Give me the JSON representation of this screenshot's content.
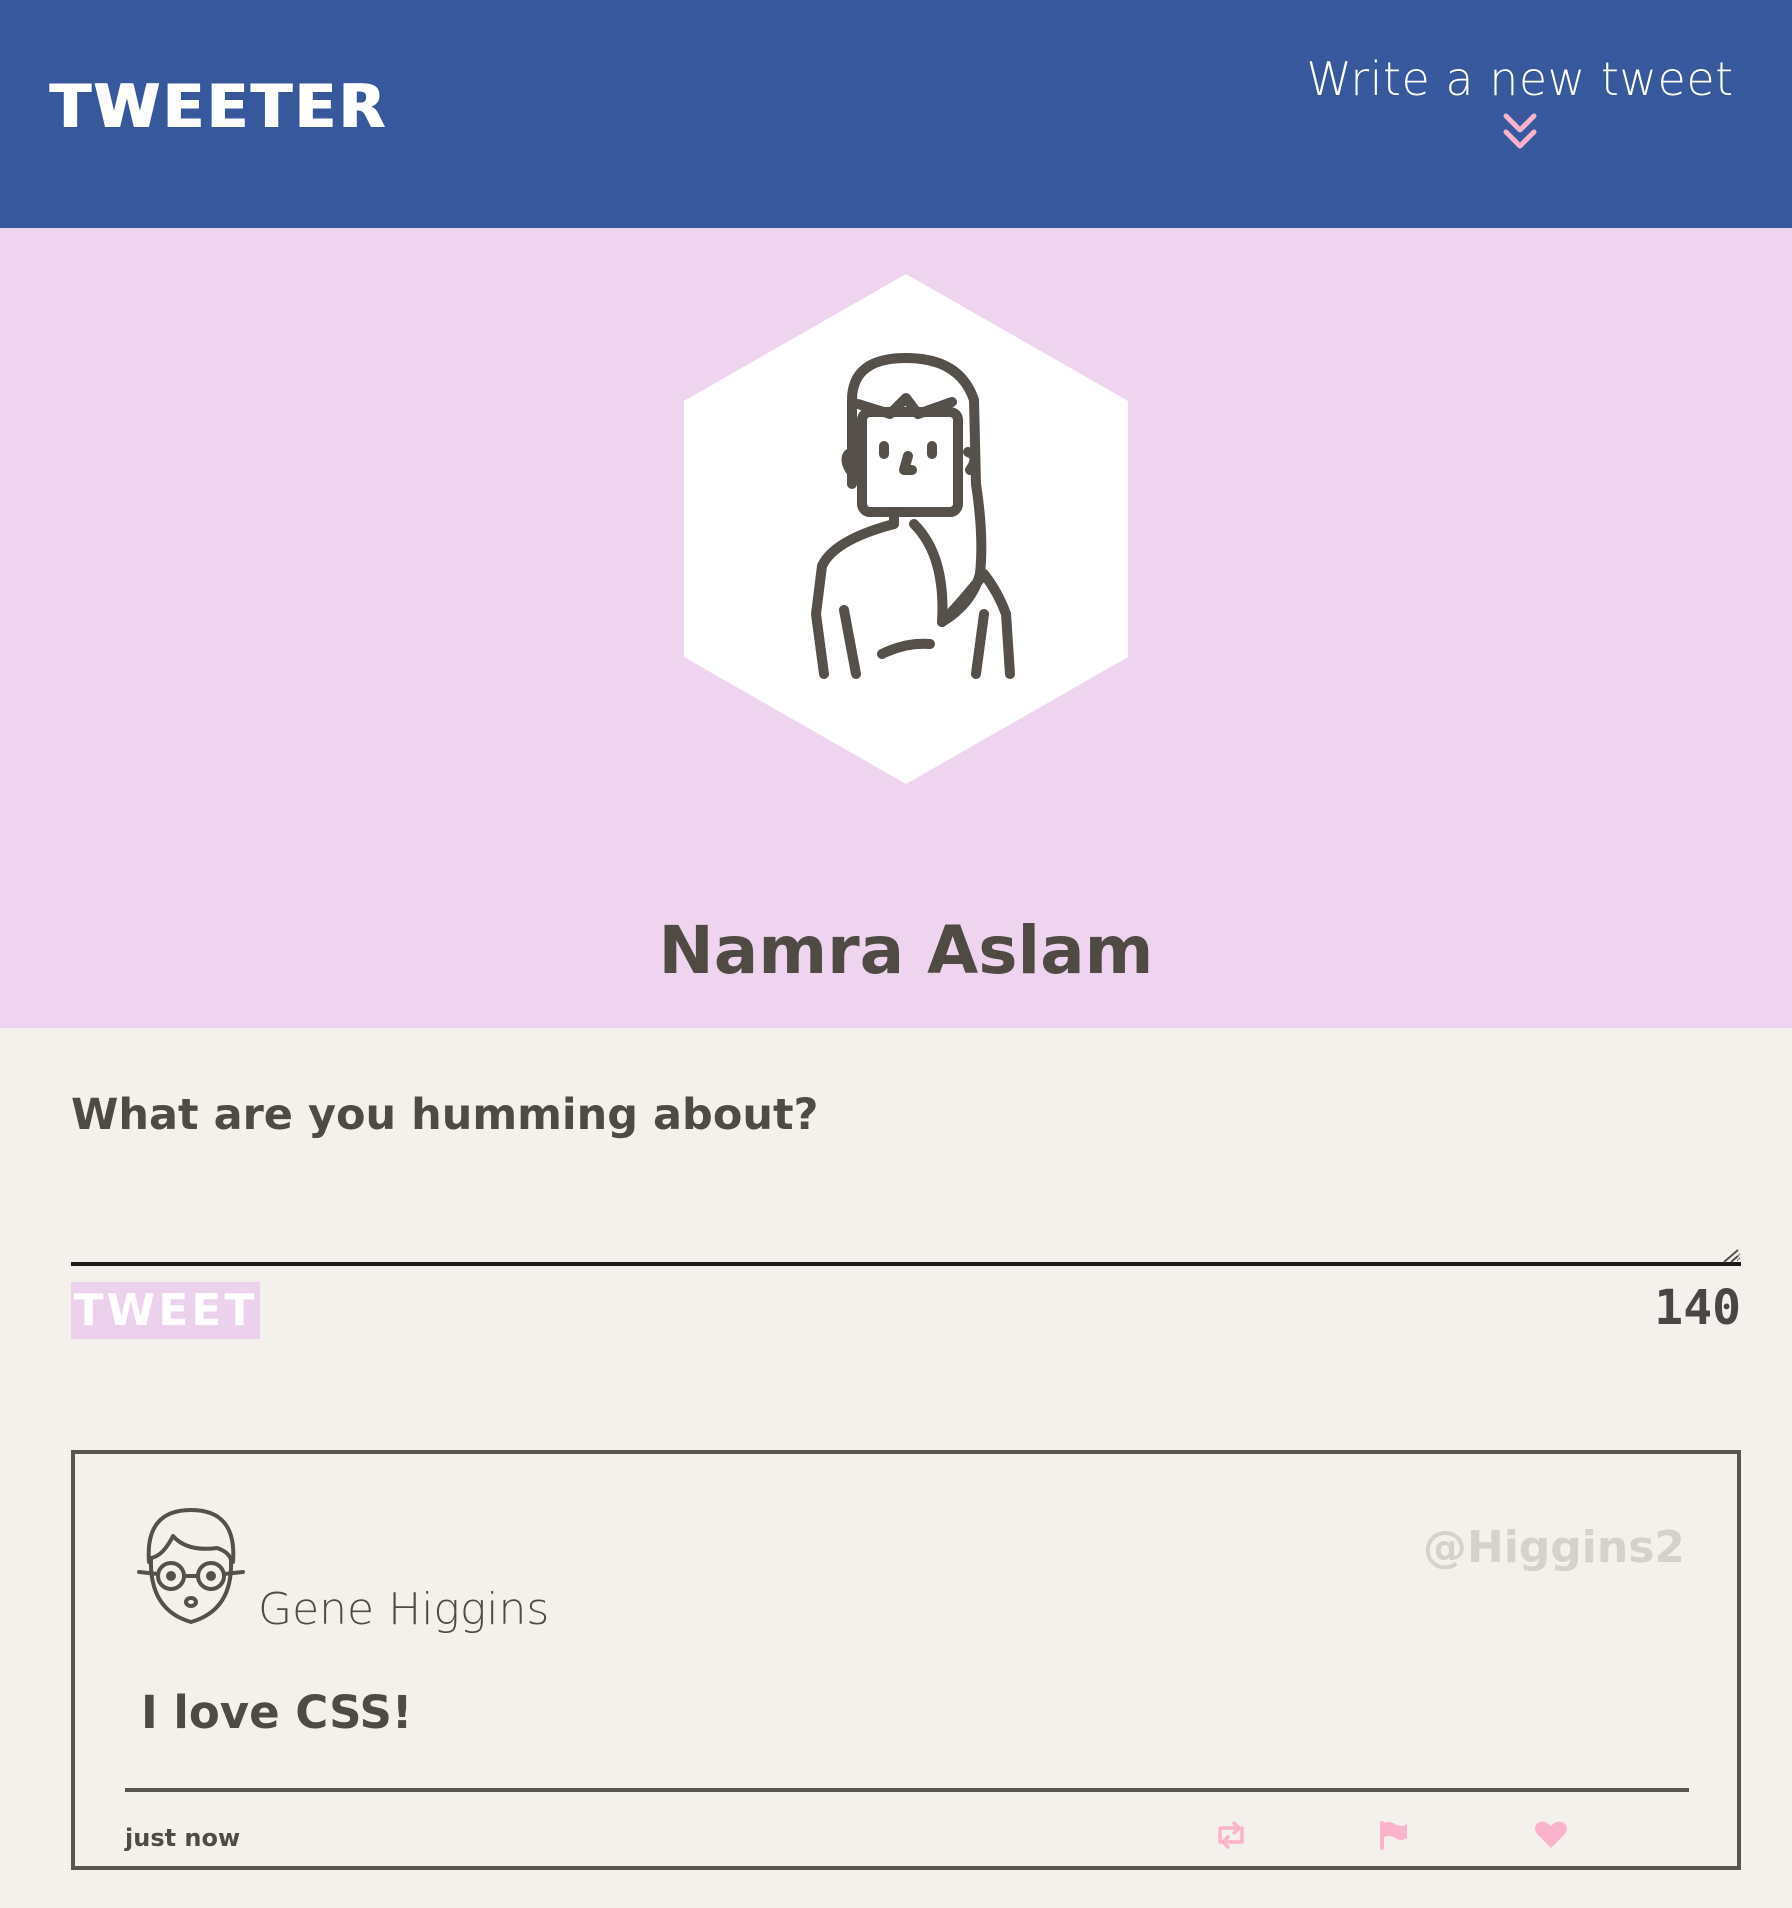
{
  "nav": {
    "brand": "TWEETER",
    "write_label": "Write a new tweet",
    "write_icon": "chevron-double-down-icon",
    "accent_color": "#fbb3cb"
  },
  "profile": {
    "name": "Namra Aslam",
    "background_color": "#eed4ee",
    "avatar_icon": "user-avatar-woman"
  },
  "compose": {
    "label": "What are you humming about?",
    "input_value": "",
    "input_placeholder": "",
    "button_label": "TWEET",
    "counter": "140"
  },
  "tweets": [
    {
      "author": "Gene Higgins",
      "handle": "@Higgins2",
      "body": "I love CSS!",
      "time": "just now",
      "avatar_icon": "user-avatar-man-glasses",
      "actions": [
        "retweet-icon",
        "flag-icon",
        "heart-icon"
      ]
    }
  ],
  "colors": {
    "nav": "#38589e",
    "page": "#f4f1ec",
    "text": "#4f4a44",
    "handle": "#d5d2cd",
    "action_icons": "#fbb3cb"
  }
}
